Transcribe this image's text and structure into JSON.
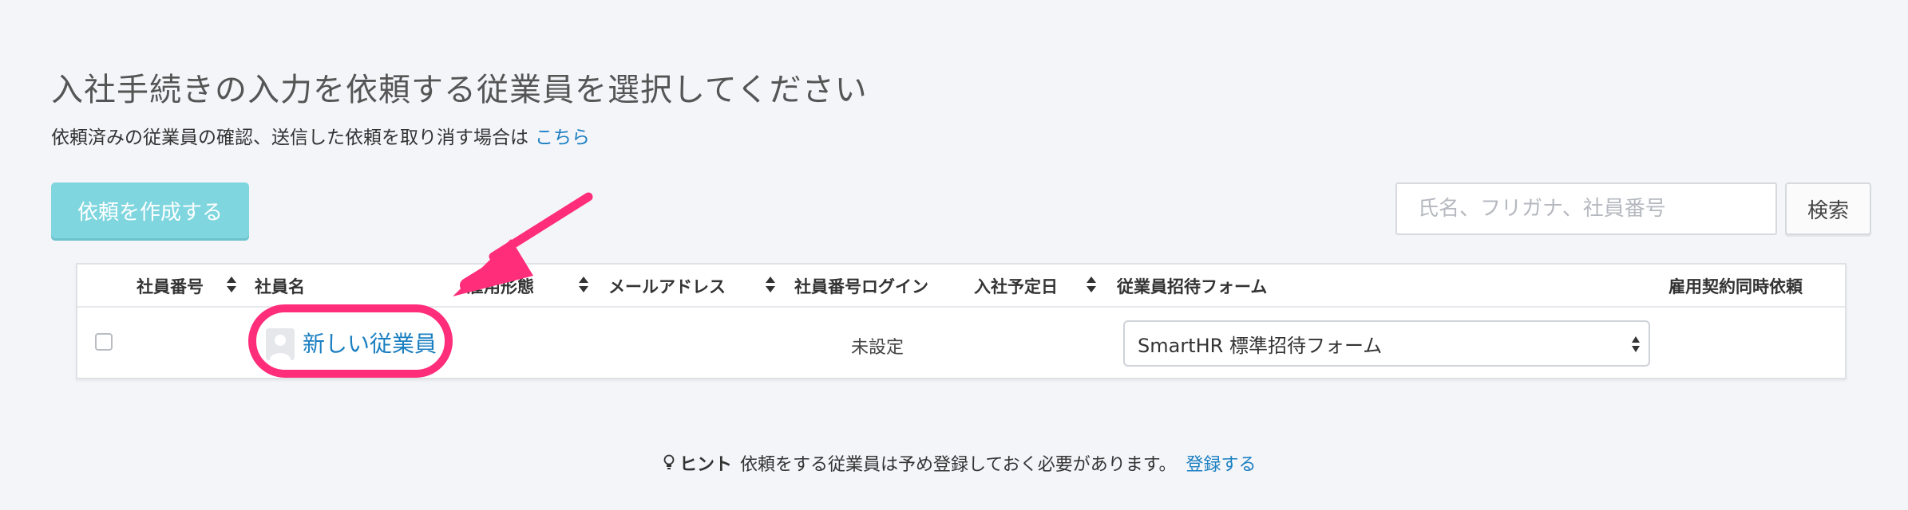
{
  "header": {
    "title": "入社手続きの入力を依頼する従業員を選択してください",
    "subtitle_text": "依頼済みの従業員の確認、送信した依頼を取り消す場合は",
    "subtitle_link": "こちら"
  },
  "toolbar": {
    "create_label": "依頼を作成する",
    "search_placeholder": "氏名、フリガナ、社員番号",
    "search_button": "検索"
  },
  "table": {
    "columns": [
      {
        "label": "社員番号",
        "sortable": true
      },
      {
        "label": "社員名",
        "sortable": false
      },
      {
        "label": "雇用形態",
        "sortable": true
      },
      {
        "label": "メールアドレス",
        "sortable": true
      },
      {
        "label": "社員番号ログイン",
        "sortable": false
      },
      {
        "label": "入社予定日",
        "sortable": true
      },
      {
        "label": "従業員招待フォーム",
        "sortable": false
      },
      {
        "label": "雇用契約同時依頼",
        "sortable": false
      }
    ],
    "rows": [
      {
        "checked": false,
        "employee_number": "",
        "name": "新しい従業員",
        "employment_type": "",
        "email": "",
        "number_login": "未設定",
        "join_date": "",
        "invite_form": "SmartHR 標準招待フォーム"
      }
    ]
  },
  "hint": {
    "title": "ヒント",
    "text": "依頼をする従業員は予め登録しておく必要があります。",
    "link": "登録する"
  },
  "annotation": {
    "color": "#ff2d7a"
  }
}
